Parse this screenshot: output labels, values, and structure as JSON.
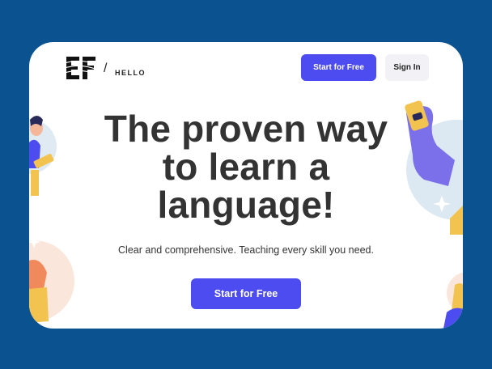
{
  "header": {
    "brand_slash": "/",
    "brand_sub": "HELLO",
    "start_free_label": "Start for Free",
    "sign_in_label": "Sign In"
  },
  "hero": {
    "headline": "The proven way to learn a language!",
    "subtext": "Clear and comprehensive. Teaching every skill you need.",
    "cta_label": "Start for Free"
  },
  "colors": {
    "page_background": "#0a5290",
    "card_background": "#ffffff",
    "primary_button": "#4c4cf0",
    "secondary_button": "#f2f2f6",
    "text": "#333333"
  },
  "icons": [
    "ef-logo-icon",
    "person-illustration",
    "hand-phone-illustration",
    "sparkle-icon"
  ]
}
